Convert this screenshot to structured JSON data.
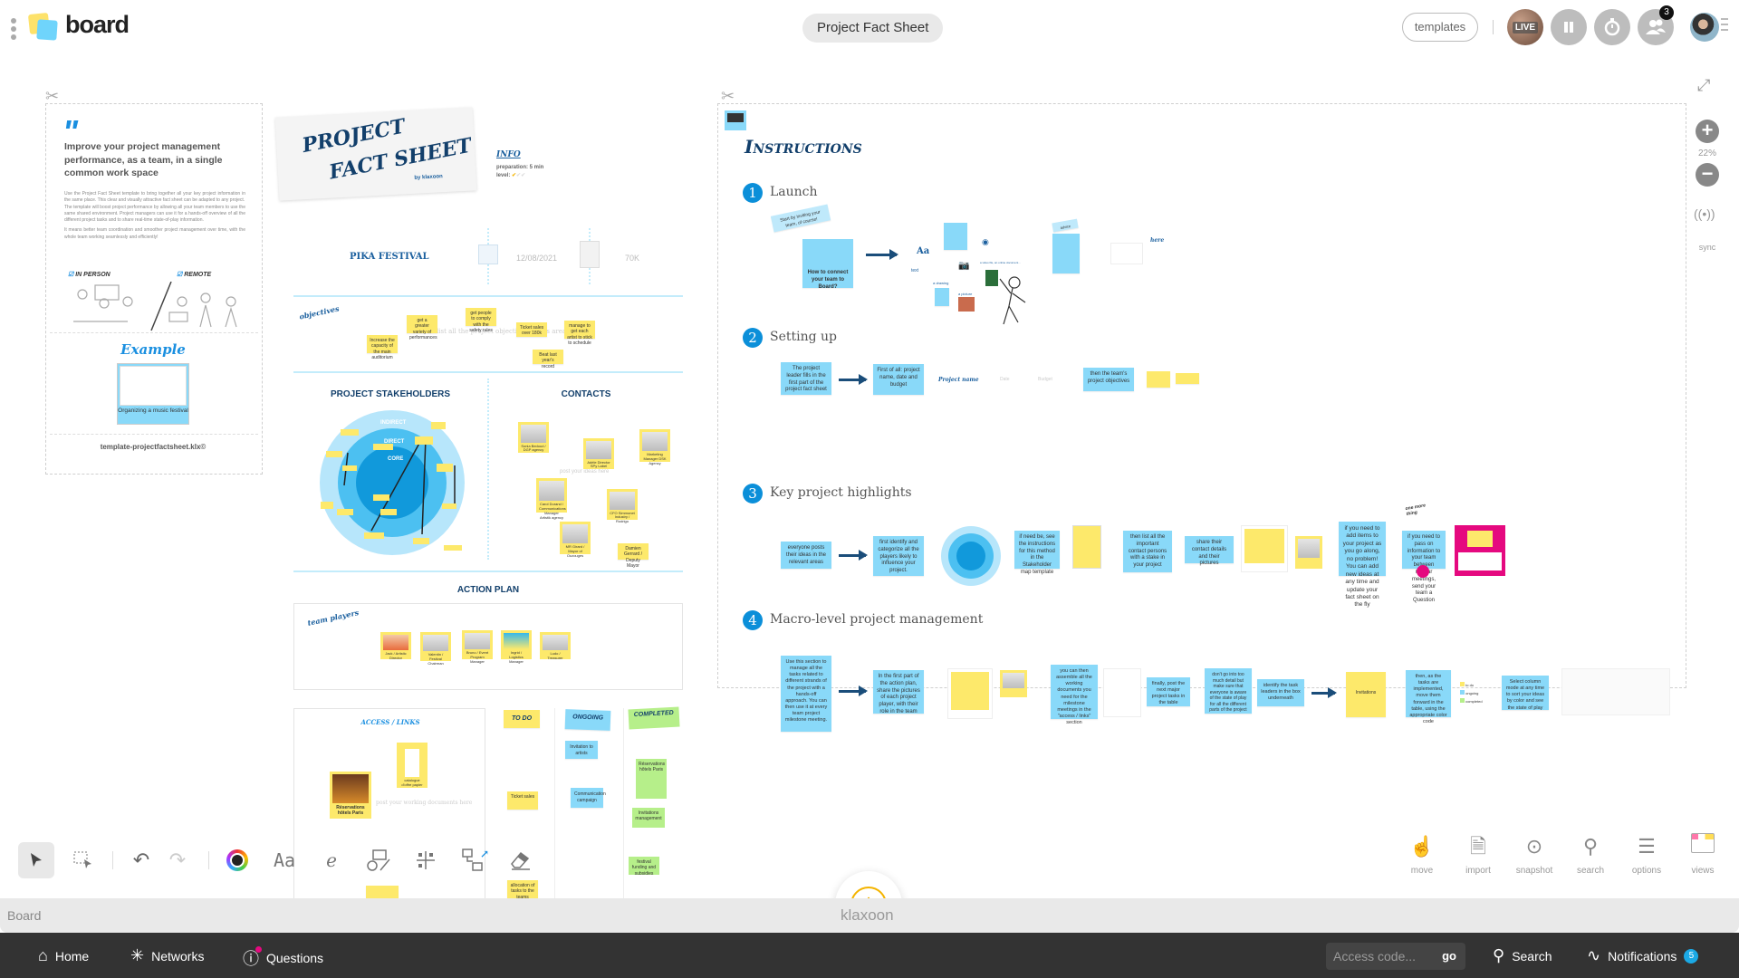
{
  "app": {
    "name": "board",
    "board_title": "Project Fact Sheet",
    "brand": "klaxoon",
    "status_label": "Board"
  },
  "header": {
    "templates_label": "templates",
    "live_label": "LIVE",
    "participants_count": "3"
  },
  "zoom": {
    "level": "22%",
    "sync_label": "sync"
  },
  "intro_card": {
    "headline": "Improve your project management performance, as a team, in a single common work space",
    "paragraphs": [
      "Use the Project Fact Sheet template to bring together all your key project information in the same place. This clear and visually attractive fact sheet can be adapted to any project.",
      "The template will boost project performance by allowing all your team members to use the same shared environment. Project managers can use it for a hands-off overview of all the different project tasks and to share real-time state-of-play information.",
      "It means better team coordination and smoother project management over time, with the whole team working seamlessly and efficiently!"
    ],
    "mode_in_person": "IN PERSON",
    "mode_remote": "REMOTE",
    "example_title": "Example",
    "example_caption": "Organizing a music festival",
    "filename": "template-projectfactsheet.klx©"
  },
  "fact_sheet": {
    "title_line1": "PROJECT",
    "title_line2": "FACT SHEET",
    "by": "by klaxoon",
    "info_title": "INFO",
    "preparation": "preparation: 5 min",
    "level": "level:",
    "project_name": "PIKA FESTIVAL",
    "date": "12/08/2021",
    "budget": "70K",
    "objectives_label": "objectives",
    "objectives_placeholder": "list all the project objectives in this area",
    "objectives": [
      "Increase the capacity of the main auditorium",
      "get a greater variety of performances",
      "get people to comply with the safety rules",
      "Ticket sales over 180k",
      "manage to get each artist to stick to schedule",
      "Beat last year's record"
    ],
    "stakeholders_title": "PROJECT STAKEHOLDERS",
    "rings": [
      "INDIRECT",
      "DIRECT",
      "CORE"
    ],
    "contacts_title": "CONTACTS",
    "contacts_placeholder": "post your ideas here",
    "contacts": [
      "Sonia Bedoud / DGP agency",
      "Adèle Director SPy Label",
      "Marketing Manager DSK Agency",
      "Carol Durand / Communications Manager Artistik agency",
      "CFO Simmonet Industry / Rodrigo",
      "MR Girard / Mayor of Ouzouges",
      "Damien Gerrard / Deputy Mayor"
    ],
    "action_plan_title": "ACTION PLAN",
    "team_players_label": "team players",
    "team": [
      "Jack / Artistic Director",
      "Valentin / Festival Chairman",
      "Bruno / Event Program Manager",
      "Ingrid / Logistics Manager",
      "Ludo / Treasurer"
    ],
    "access_links_title": "ACCESS / LINKS",
    "access_placeholder": "post your working documents here",
    "docs": [
      "Réservations hôtels Paris",
      "catalogue d'offre papier"
    ],
    "columns": [
      {
        "title": "TO DO",
        "color": "#fde96b",
        "cards": [
          "Ticket sales",
          "allocation of tasks to the teams"
        ]
      },
      {
        "title": "ONGOING",
        "color": "#89d9f9",
        "cards": [
          "Invitation to artists",
          "Communication campaign"
        ]
      },
      {
        "title": "COMPLETED",
        "color": "#b6ef8a",
        "cards": [
          "Réservations hôtels Paris",
          "Invitations management",
          "festival funding and subsidies"
        ]
      }
    ]
  },
  "instructions": {
    "title": "Instructions",
    "steps": [
      {
        "num": "1",
        "label": "Launch",
        "notes": [
          "Start by inviting your team, of course!",
          "How to connect your team to Board?",
          "text",
          "a drawing",
          "a picture",
          "a video file, an online document...",
          "advice",
          "here"
        ]
      },
      {
        "num": "2",
        "label": "Setting up",
        "notes": [
          "The project leader fills in the first part of the project fact sheet",
          "First of all: project name, date and budget",
          "Project name",
          "Date",
          "Budget",
          "then the team's project objectives"
        ]
      },
      {
        "num": "3",
        "label": "Key project highlights",
        "notes": [
          "everyone posts their ideas in the relevant areas",
          "first identify and categorize all the players likely to influence your project.",
          "if need be, see the instructions for this method in the Stakeholder map template",
          "then list all the important contact persons with a stake in your project",
          "share their contact details and their pictures",
          "if you need to add items to your project as you go along, no problem! You can add new ideas at any time and update your fact sheet on the fly",
          "one more thing",
          "if you need to pass on information to your team between regular meetings, send your team a Question"
        ]
      },
      {
        "num": "4",
        "label": "Macro-level project management",
        "notes": [
          "Use this section to manage all the tasks related to different strands of the project with a hands-off approach. You can then use it at every team project milestone meeting.",
          "In the first part of the action plan, share the pictures of each project player, with their role in the team",
          "you can then assemble all the working documents you need for the milestone meetings in the \"access / links\" section",
          "finally, post the next major project tasks in the table",
          "don't go into too much detail but make sure that everyone is aware of the state of play for all the different parts of the project",
          "identify the task leaders in the box underneath",
          "Invitations",
          "then, as the tasks are implemented, move them forward in the table, using the appropriate color code",
          "to do",
          "ongoing",
          "completed",
          "Select column mode at any time to sort your ideas by color and see the state of play"
        ]
      }
    ]
  },
  "toolbar": {
    "tools": [
      "select",
      "multi-select",
      "undo",
      "redo",
      "color",
      "text",
      "draw",
      "shapes",
      "grid",
      "connector",
      "eraser"
    ],
    "right": [
      "move",
      "import",
      "snapshot",
      "search",
      "options",
      "views"
    ]
  },
  "nav": {
    "home": "Home",
    "networks": "Networks",
    "questions": "Questions",
    "access_placeholder": "Access code...",
    "go": "go",
    "search": "Search",
    "notifications": "Notifications",
    "notifications_count": "5"
  },
  "colors": {
    "accent_blue": "#0b8fd9",
    "sticky_yellow": "#fde96b",
    "sticky_blue": "#89d9f9",
    "sticky_green": "#b6ef8a",
    "nav_bg": "#333333",
    "add_ring": "#f4b400",
    "question_pink": "#e5097f"
  }
}
